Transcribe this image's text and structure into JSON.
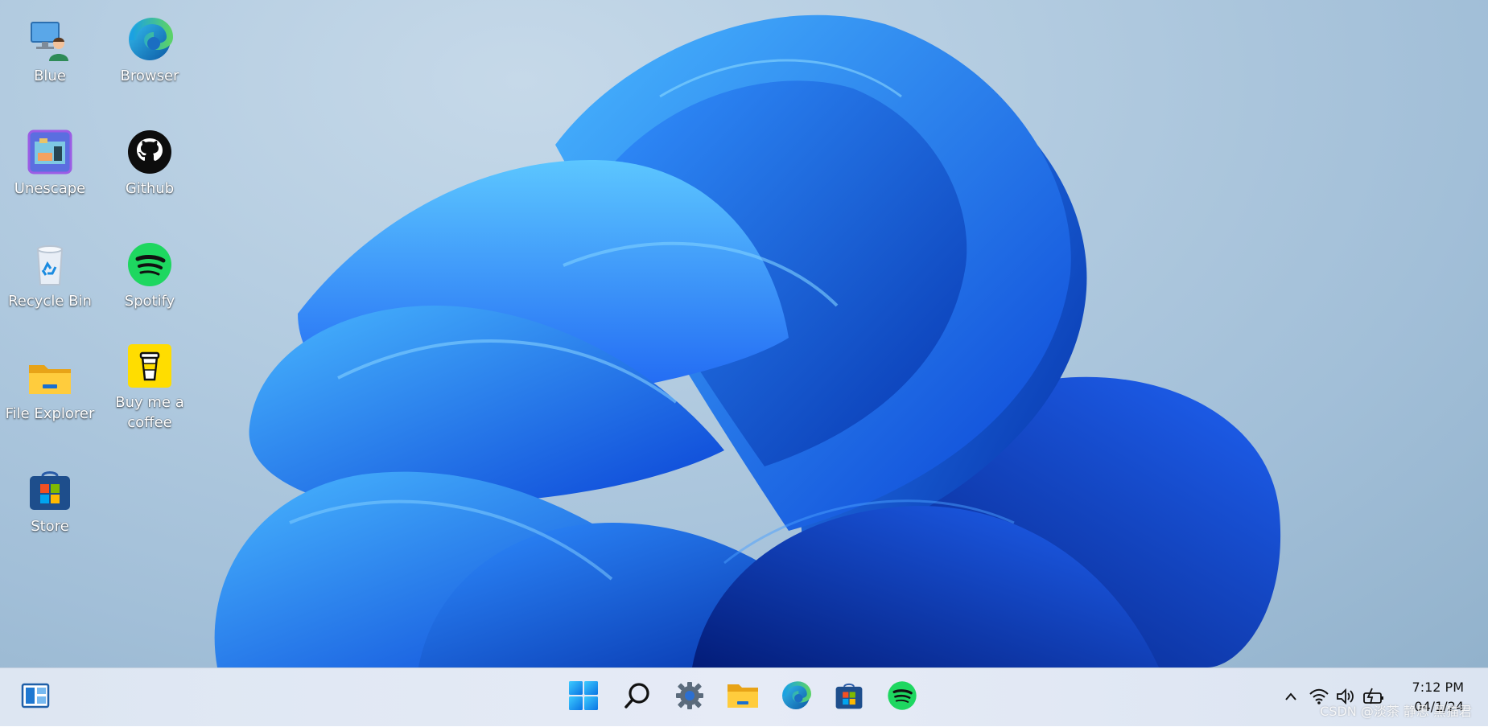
{
  "desktop": {
    "icons": [
      {
        "label": "Blue",
        "icon": "user-computer-icon"
      },
      {
        "label": "Browser",
        "icon": "edge-icon"
      },
      {
        "label": "Unescape",
        "icon": "unescape-game-icon"
      },
      {
        "label": "Github",
        "icon": "github-icon"
      },
      {
        "label": "Recycle Bin",
        "icon": "recycle-bin-icon"
      },
      {
        "label": "Spotify",
        "icon": "spotify-icon"
      },
      {
        "label": "File Explorer",
        "icon": "folder-icon"
      },
      {
        "label": "Buy me a coffee",
        "icon": "coffee-cup-icon"
      },
      {
        "label": "Store",
        "icon": "store-bag-icon"
      }
    ]
  },
  "taskbar": {
    "widgets_icon": "widgets-icon",
    "apps": [
      {
        "icon": "windows-start-icon"
      },
      {
        "icon": "search-icon"
      },
      {
        "icon": "settings-gear-icon"
      },
      {
        "icon": "file-explorer-icon"
      },
      {
        "icon": "edge-icon"
      },
      {
        "icon": "store-icon"
      },
      {
        "icon": "spotify-icon"
      }
    ],
    "tray": {
      "chevron_icon": "chevron-up-icon",
      "wifi_icon": "wifi-icon",
      "volume_icon": "volume-icon",
      "battery_icon": "battery-charging-icon",
      "time": "7:12 PM",
      "date": "04/1/24"
    },
    "watermark": "CSDN @淡茶 静思 黑猫君"
  },
  "colors": {
    "accent": "#1a6cff",
    "spotify": "#1ed760",
    "coffee": "#ffdd00"
  }
}
